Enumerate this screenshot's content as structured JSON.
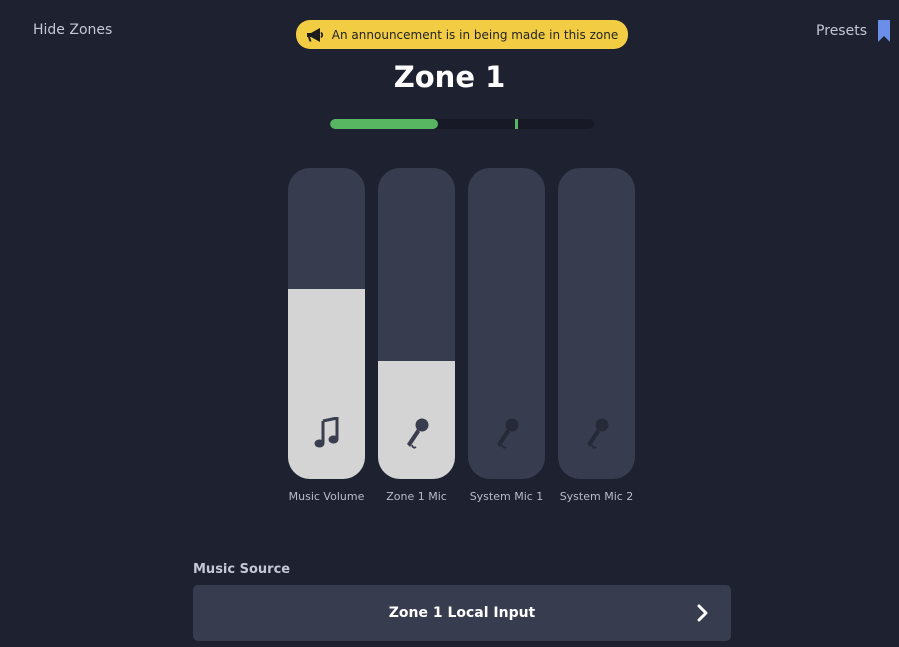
{
  "header": {
    "hide_zones_label": "Hide Zones",
    "presets_label": "Presets",
    "presets_icon": "bookmark-icon"
  },
  "banner": {
    "text": "An announcement is in being made in this zone",
    "icon": "megaphone-icon",
    "color": "#f2cd44"
  },
  "zone": {
    "title": "Zone 1"
  },
  "meter": {
    "level": 0.41,
    "peak": 0.7,
    "color": "#58b662"
  },
  "sliders": [
    {
      "label": "Music Volume",
      "icon": "music-note-icon",
      "level": 0.61
    },
    {
      "label": "Zone 1 Mic",
      "icon": "microphone-icon",
      "level": 0.38
    },
    {
      "label": "System Mic 1",
      "icon": "microphone-icon",
      "level": 0
    },
    {
      "label": "System Mic 2",
      "icon": "microphone-icon",
      "level": 0
    }
  ],
  "music_source": {
    "label": "Music Source",
    "value": "Zone 1 Local Input",
    "icon": "chevron-right-icon"
  },
  "colors": {
    "background": "#1e2130",
    "track": "#383c4f",
    "fill": "#d4d4d4",
    "accent_blue": "#6b8ee8"
  }
}
